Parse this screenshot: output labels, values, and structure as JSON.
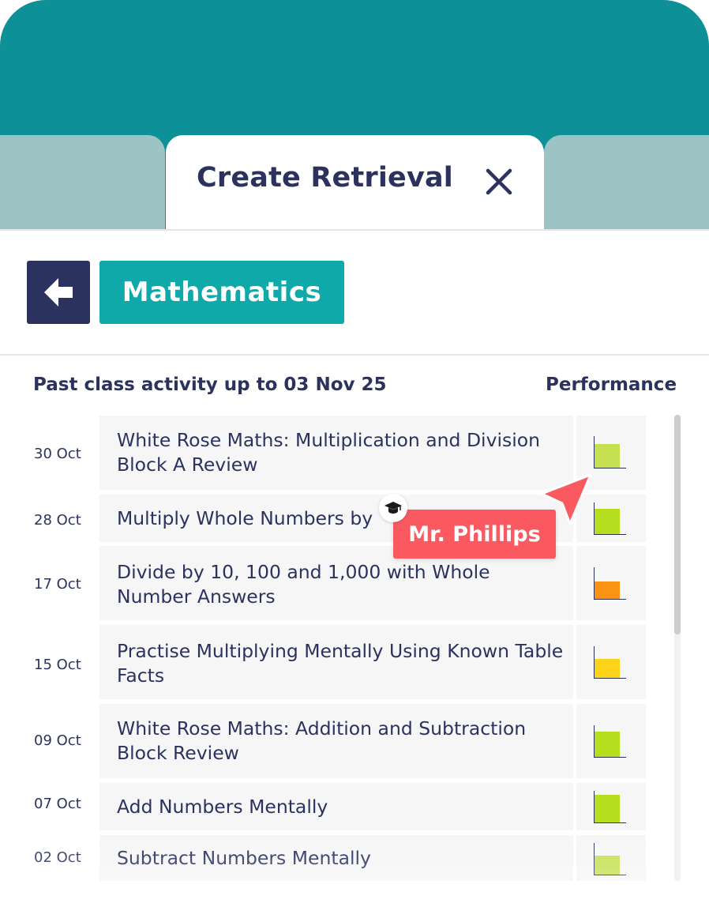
{
  "tab": {
    "title": "Create Retrieval",
    "close_icon": "close-icon"
  },
  "toolbar": {
    "back_icon": "arrow-left-icon",
    "subject": "Mathematics"
  },
  "list": {
    "heading": "Past class activity up to 03 Nov 25",
    "performance_heading": "Performance",
    "items": [
      {
        "date": "30 Oct",
        "title": "White Rose Maths: Multiplication and Division Block A Review",
        "performance": 0.75,
        "color": "#c6e052"
      },
      {
        "date": "28 Oct",
        "title": "Multiply Whole Numbers by",
        "performance": 0.8,
        "color": "#b5de1f"
      },
      {
        "date": "17 Oct",
        "title": "Divide by 10, 100 and 1,000 with Whole Number Answers",
        "performance": 0.55,
        "color": "#f99311"
      },
      {
        "date": "15 Oct",
        "title": "Practise Multiplying Mentally Using Known Table Facts",
        "performance": 0.6,
        "color": "#fdd319"
      },
      {
        "date": "09 Oct",
        "title": "White Rose Maths: Addition and Subtraction Block Review",
        "performance": 0.8,
        "color": "#b5de1f"
      },
      {
        "date": "07 Oct",
        "title": "Add Numbers Mentally",
        "performance": 0.88,
        "color": "#b5de1f"
      },
      {
        "date": "02 Oct",
        "title": "Subtract Numbers Mentally",
        "performance": 0.6,
        "color": "#c6e052"
      }
    ]
  },
  "cursor": {
    "name": "Mr. Phillips",
    "badge_icon": "graduation-cap-icon",
    "color": "#fa5a5f"
  }
}
